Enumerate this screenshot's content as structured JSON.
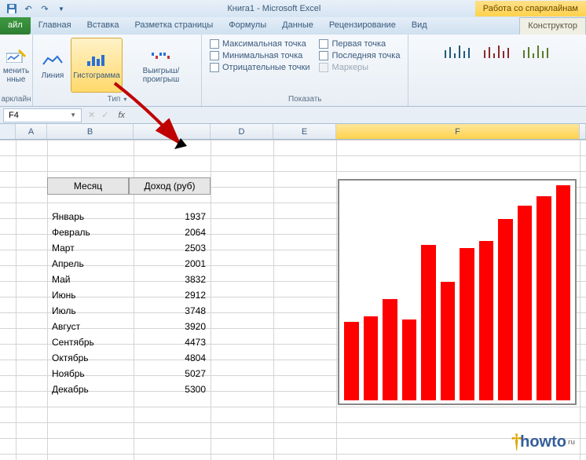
{
  "title": "Книга1 - Microsoft Excel",
  "context_tab_title": "Работа со спарклайнам",
  "tabs": {
    "file": "айл",
    "home": "Главная",
    "insert": "Вставка",
    "layout": "Разметка страницы",
    "formulas": "Формулы",
    "data": "Данные",
    "review": "Рецензирование",
    "view": "Вид",
    "design": "Конструктор"
  },
  "ribbon": {
    "group_edit": {
      "btn": "менить\nнные",
      "label": "арклайн"
    },
    "group_type": {
      "line": "Линия",
      "hist": "Гистограмма",
      "winlose": "Выигрыш/проигрыш",
      "label": "Тип"
    },
    "group_show": {
      "max": "Максимальная точка",
      "min": "Минимальная точка",
      "neg": "Отрицательные точки",
      "first": "Первая точка",
      "last": "Последняя точка",
      "markers": "Маркеры",
      "label": "Показать"
    }
  },
  "namebox": "F4",
  "columns": [
    "A",
    "B",
    "C",
    "D",
    "E",
    "F"
  ],
  "table": {
    "hdr_month": "Месяц",
    "hdr_income": "Доход (руб)",
    "rows": [
      {
        "m": "Январь",
        "v": "1937"
      },
      {
        "m": "Февраль",
        "v": "2064"
      },
      {
        "m": "Март",
        "v": "2503"
      },
      {
        "m": "Апрель",
        "v": "2001"
      },
      {
        "m": "Май",
        "v": "3832"
      },
      {
        "m": "Июнь",
        "v": "2912"
      },
      {
        "m": "Июль",
        "v": "3748"
      },
      {
        "m": "Август",
        "v": "3920"
      },
      {
        "m": "Сентябрь",
        "v": "4473"
      },
      {
        "m": "Октябрь",
        "v": "4804"
      },
      {
        "m": "Ноябрь",
        "v": "5027"
      },
      {
        "m": "Декабрь",
        "v": "5300"
      }
    ]
  },
  "chart_data": {
    "type": "bar",
    "categories": [
      "Январь",
      "Февраль",
      "Март",
      "Апрель",
      "Май",
      "Июнь",
      "Июль",
      "Август",
      "Сентябрь",
      "Октябрь",
      "Ноябрь",
      "Декабрь"
    ],
    "values": [
      1937,
      2064,
      2503,
      2001,
      3832,
      2912,
      3748,
      3920,
      4473,
      4804,
      5027,
      5300
    ],
    "title": "",
    "xlabel": "",
    "ylabel": "",
    "ylim": [
      0,
      5300
    ],
    "color": "#ff0000"
  },
  "logo": {
    "brand": "howto",
    "tld": "ru"
  }
}
